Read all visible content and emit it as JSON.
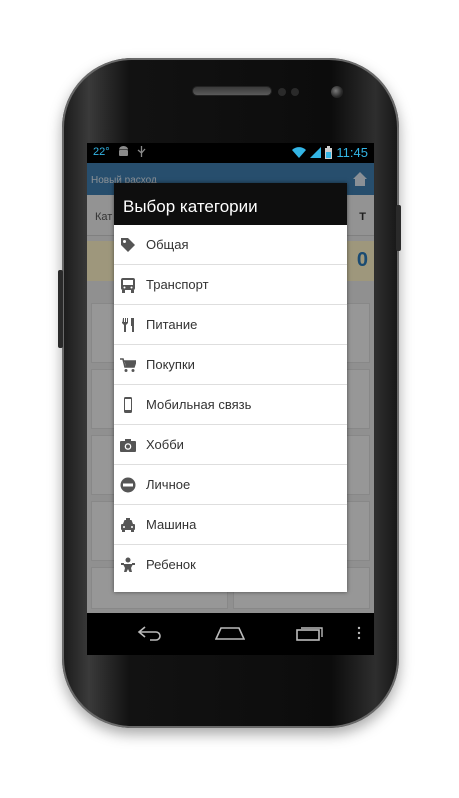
{
  "status_bar": {
    "temperature": "22°",
    "time": "11:45",
    "icons": [
      "android-icon",
      "usb-icon",
      "wifi-icon",
      "signal-icon",
      "battery-icon"
    ]
  },
  "background_app": {
    "header_title": "Новый расход",
    "row_label": "Кат",
    "row_tail": "Т",
    "amount_tail": "0"
  },
  "dialog": {
    "title": "Выбор категории",
    "items": [
      {
        "label": "Общая",
        "icon": "tag-icon"
      },
      {
        "label": "Транспорт",
        "icon": "bus-icon"
      },
      {
        "label": "Питание",
        "icon": "fork-knife-icon"
      },
      {
        "label": "Покупки",
        "icon": "cart-icon"
      },
      {
        "label": "Мобильная связь",
        "icon": "mobile-phone-icon"
      },
      {
        "label": "Хобби",
        "icon": "camera-icon"
      },
      {
        "label": "Личное",
        "icon": "no-entry-icon"
      },
      {
        "label": "Машина",
        "icon": "car-icon"
      },
      {
        "label": "Ребенок",
        "icon": "baby-icon"
      }
    ]
  },
  "nav_bar": {
    "buttons": [
      "back-icon",
      "home-icon",
      "recent-apps-icon",
      "overflow-menu-icon"
    ]
  },
  "colors": {
    "accent": "#33b5e5",
    "dialog_title_bg": "#0e0e0e",
    "app_header": "#3f7fb0",
    "icon_gray": "#555555"
  }
}
